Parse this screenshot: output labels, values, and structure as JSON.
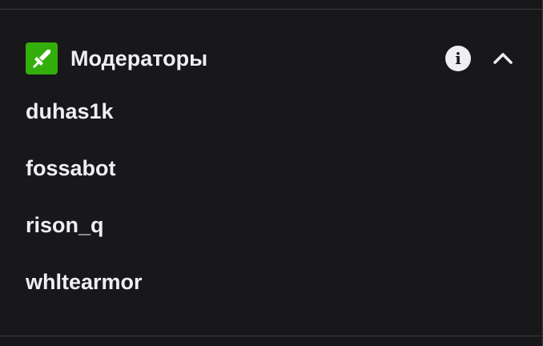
{
  "section": {
    "title": "Модераторы",
    "badge_icon": "sword-icon",
    "badge_color": "#34ae0a",
    "info_icon": "info-icon",
    "collapse_icon": "chevron-up-icon"
  },
  "moderators": [
    {
      "name": "duhas1k"
    },
    {
      "name": "fossabot"
    },
    {
      "name": "rison_q"
    },
    {
      "name": "whltearmor"
    }
  ]
}
